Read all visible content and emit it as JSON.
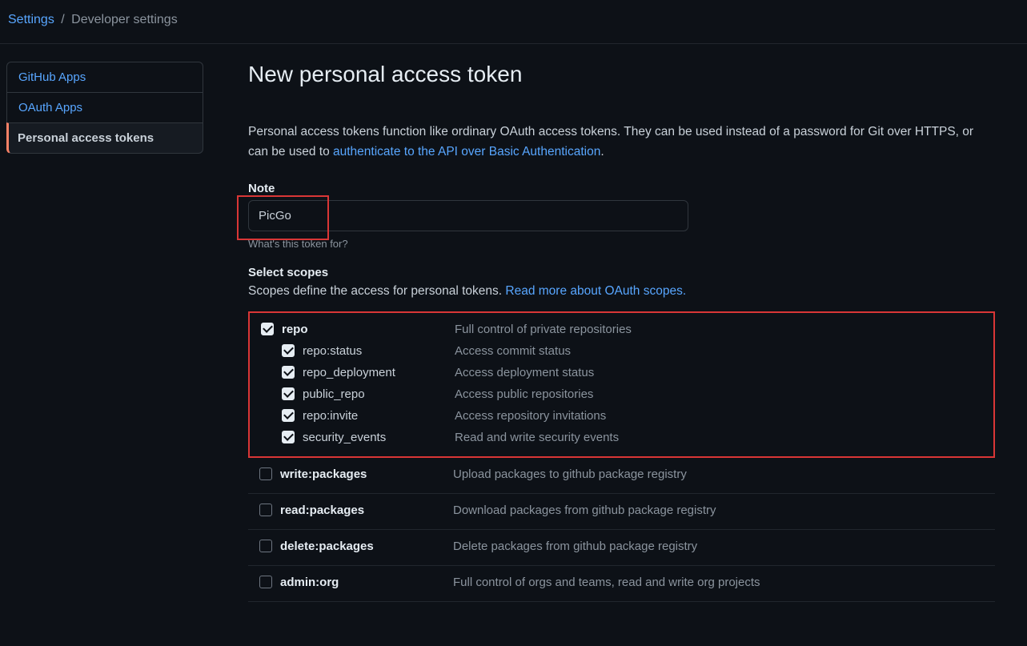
{
  "breadcrumb": {
    "settings": "Settings",
    "current": "Developer settings"
  },
  "sidebar": {
    "items": [
      {
        "label": "GitHub Apps"
      },
      {
        "label": "OAuth Apps"
      },
      {
        "label": "Personal access tokens"
      }
    ]
  },
  "main": {
    "title": "New personal access token",
    "description_pre": "Personal access tokens function like ordinary OAuth access tokens. They can be used instead of a password for Git over HTTPS, or can be used to ",
    "description_link": "authenticate to the API over Basic Authentication",
    "note_label": "Note",
    "note_value": "PicGo",
    "note_hint": "What's this token for?",
    "scopes_label": "Select scopes",
    "scopes_desc_pre": "Scopes define the access for personal tokens. ",
    "scopes_desc_link": "Read more about OAuth scopes."
  },
  "scopes_highlighted": {
    "parent": {
      "name": "repo",
      "desc": "Full control of private repositories",
      "checked": true
    },
    "children": [
      {
        "name": "repo:status",
        "desc": "Access commit status",
        "checked": true
      },
      {
        "name": "repo_deployment",
        "desc": "Access deployment status",
        "checked": true
      },
      {
        "name": "public_repo",
        "desc": "Access public repositories",
        "checked": true
      },
      {
        "name": "repo:invite",
        "desc": "Access repository invitations",
        "checked": true
      },
      {
        "name": "security_events",
        "desc": "Read and write security events",
        "checked": true
      }
    ]
  },
  "scopes_after": [
    {
      "name": "write:packages",
      "desc": "Upload packages to github package registry",
      "checked": false
    },
    {
      "name": "read:packages",
      "desc": "Download packages from github package registry",
      "checked": false
    },
    {
      "name": "delete:packages",
      "desc": "Delete packages from github package registry",
      "checked": false
    },
    {
      "name": "admin:org",
      "desc": "Full control of orgs and teams, read and write org projects",
      "checked": false
    }
  ]
}
